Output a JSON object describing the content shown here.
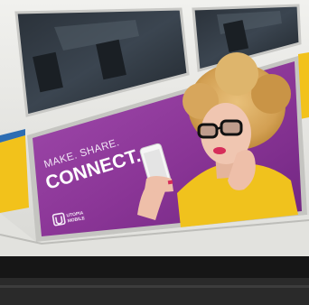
{
  "billboard": {
    "tagline_line1": "MAKE. SHARE.",
    "tagline_line2": "CONNECT.",
    "brand_line1": "UTOPIA",
    "brand_line2": "MOBILE"
  },
  "colors": {
    "bus_body": "#e9e9e6",
    "bus_stripe_yellow": "#f2c21b",
    "billboard_purple": "#8f3b9b",
    "shirt_yellow": "#f0c21d",
    "hair_blonde": "#d9a85a",
    "road": "#1e1e1e"
  },
  "icons": [
    "utopia-mobile-logo-icon",
    "smartphone-icon"
  ]
}
